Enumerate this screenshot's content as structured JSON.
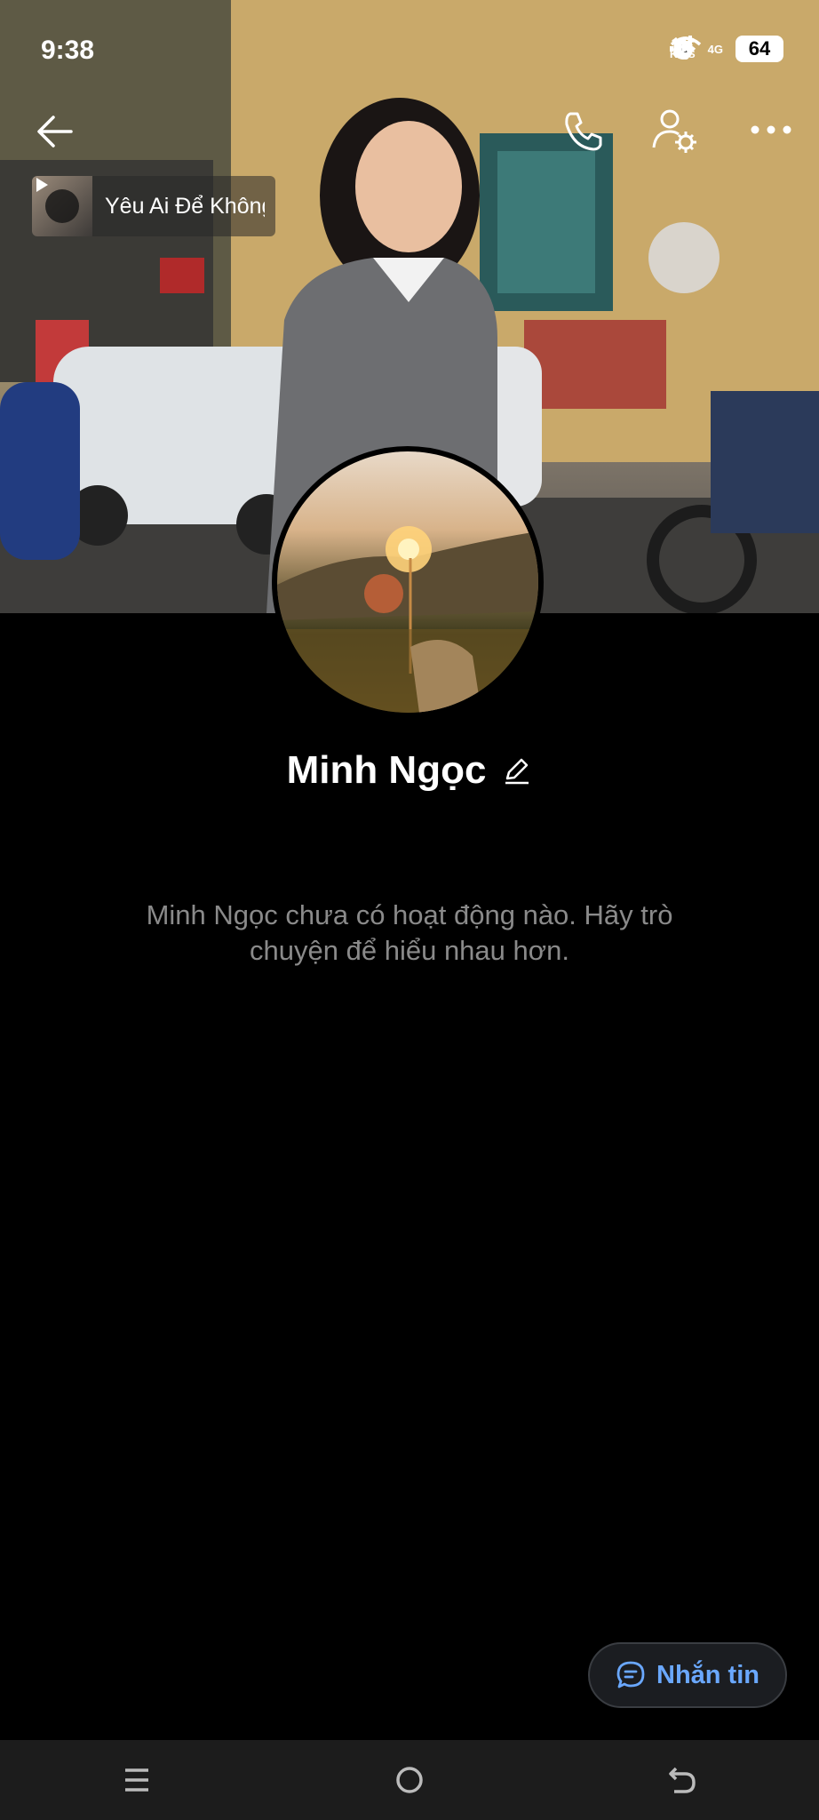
{
  "status_bar": {
    "time": "9:38",
    "speed_value": "7,03",
    "speed_unit": "KB/S",
    "network": "4G",
    "battery": "64"
  },
  "header": {
    "back_icon": "arrow-left-icon",
    "call_icon": "phone-icon",
    "profile_settings_icon": "user-gear-icon",
    "more_icon": "more-horizontal-icon"
  },
  "music": {
    "title": "Yêu Ai Để Không"
  },
  "profile": {
    "name": "Minh Ngọc",
    "empty_message": "Minh Ngọc chưa có hoạt động nào. Hãy trò chuyện để hiểu nhau hơn."
  },
  "actions": {
    "message_label": "Nhắn tin"
  },
  "colors": {
    "accent": "#6aa8ff",
    "background": "#000000",
    "muted_text": "#8a8a8a"
  }
}
